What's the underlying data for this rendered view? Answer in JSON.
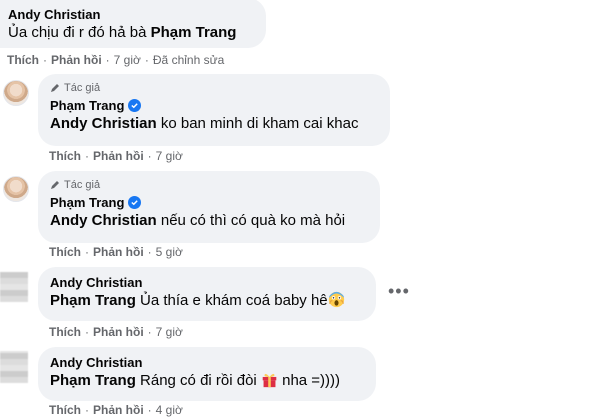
{
  "comments": [
    {
      "author": "Andy Christian",
      "mention": "",
      "text": "Ủa chịu đi r đó hả bà ",
      "text_mention": "Phạm Trang",
      "like": "Thích",
      "reply": "Phản hồi",
      "time": "7 giờ",
      "edited": "Đã chỉnh sửa"
    },
    {
      "author_tag": "Tác giả",
      "author": "Phạm Trang",
      "mention": "Andy Christian",
      "text": " ko ban minh di kham cai khac",
      "like": "Thích",
      "reply": "Phản hồi",
      "time": "7 giờ"
    },
    {
      "author_tag": "Tác giả",
      "author": "Phạm Trang",
      "mention": "Andy Christian",
      "text": " nếu có thì có quà ko mà hỏi",
      "like": "Thích",
      "reply": "Phản hồi",
      "time": "5 giờ"
    },
    {
      "author": "Andy Christian",
      "mention": "Phạm Trang",
      "text": " Ủa thía e khám coá baby hê",
      "emoji": "screaming-face",
      "like": "Thích",
      "reply": "Phản hồi",
      "time": "7 giờ"
    },
    {
      "author": "Andy Christian",
      "mention": "Phạm Trang",
      "text": " Ráng có đi rồi đòi ",
      "emoji": "gift",
      "text_after": " nha =))))",
      "like": "Thích",
      "reply": "Phản hồi",
      "time": "4 giờ"
    }
  ],
  "more_options": "•••",
  "separator": "·",
  "colors": {
    "bubble": "#f0f2f5",
    "secondary_text": "#65676b",
    "verified": "#1877f2"
  }
}
